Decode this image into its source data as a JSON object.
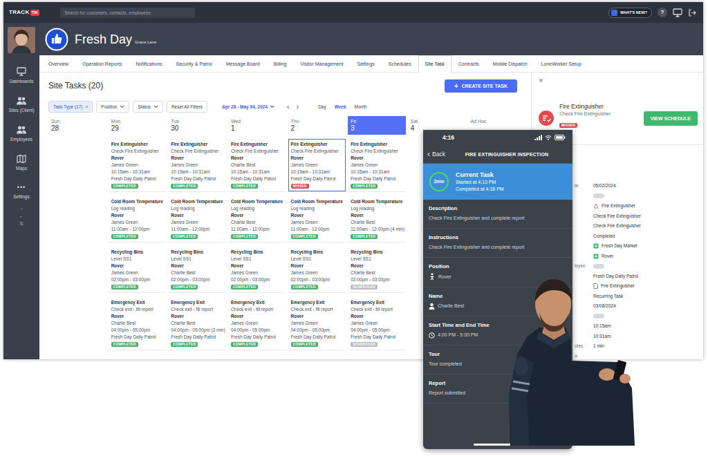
{
  "topbar": {
    "logo": {
      "word": "TRACK",
      "mark": "TIK"
    },
    "search": {
      "placeholder": "Search for customers, contacts, employees"
    },
    "whats_new": "WHAT'S NEW?",
    "help": "?"
  },
  "sidebar": {
    "items": [
      {
        "label": "Dashboards",
        "selected": false
      },
      {
        "label": "Sites (Client)",
        "selected": false
      },
      {
        "label": "Employees",
        "selected": false
      },
      {
        "label": "Maps",
        "selected": false
      },
      {
        "label": "Settings",
        "glyph": "•••",
        "selected": false
      }
    ],
    "arrows": [
      "→",
      "←",
      "⇅"
    ]
  },
  "site": {
    "name": "Fresh Day",
    "contact": "Grace Lane"
  },
  "tabs": [
    {
      "label": "Overview",
      "selected": false
    },
    {
      "label": "Operation Reports",
      "selected": false
    },
    {
      "label": "Notifications",
      "selected": false
    },
    {
      "label": "Security & Patrol",
      "selected": false
    },
    {
      "label": "Message Board",
      "selected": false
    },
    {
      "label": "Billing",
      "selected": false
    },
    {
      "label": "Visitor Management",
      "selected": false
    },
    {
      "label": "Settings",
      "selected": false
    },
    {
      "label": "Schedules",
      "selected": false
    },
    {
      "label": "Site Task",
      "selected": true
    },
    {
      "label": "Contracts",
      "selected": false
    },
    {
      "label": "Mobile Dispatch",
      "selected": false
    },
    {
      "label": "LoneWorker Setup",
      "selected": false
    }
  ],
  "page": {
    "title": "Site Tasks (20)",
    "create": {
      "glyph": "+",
      "label": "CREATE SITE TASK"
    }
  },
  "filters": [
    {
      "label": "Task Type (17)",
      "glyph": "×",
      "kind": "chip"
    },
    {
      "label": "Position",
      "kind": "dropdown"
    },
    {
      "label": "Status",
      "kind": "dropdown"
    },
    {
      "label": "Reset All Filters",
      "kind": "button"
    }
  ],
  "range": {
    "label": "Apr 28 - May 04, 2024",
    "prev": "‹",
    "next": "›"
  },
  "views": [
    {
      "label": "Day",
      "selected": false
    },
    {
      "label": "Week",
      "selected": true
    },
    {
      "label": "Month",
      "selected": false
    }
  ],
  "calendar": {
    "adhoc": "Ad Hoc",
    "days": [
      {
        "weekday": "Sun",
        "date": "28",
        "selected": false,
        "tasks": []
      },
      {
        "weekday": "Mon",
        "date": "29",
        "selected": false,
        "tasks": [
          {
            "title": "Fire Extinguisher",
            "subtitle": "Check Fire Extinguisher",
            "position": "Rover",
            "employee": "James Green",
            "time": "10:15am - 10:31am",
            "route": "Fresh Day Daily Patrol",
            "status": "COMPLETED",
            "color": "#48b16e",
            "selected": false
          },
          {
            "title": "Cold Room Temperature",
            "subtitle": "Log reading",
            "position": "Rover",
            "employee": "James Green",
            "time": "11:00am - 12:00pm",
            "status": "COMPLETED",
            "color": "#48b16e",
            "selected": false
          },
          {
            "title": "Recycling Bins",
            "subtitle": "Level SS1",
            "position": "Rover",
            "employee": "James Green",
            "time": "02:00pm - 03:00pm",
            "status": "COMPLETED",
            "color": "#48b16e",
            "selected": false
          },
          {
            "title": "Emergency Exit",
            "subtitle": "Check exit - fill report",
            "position": "Rover",
            "employee": "Charlie Best",
            "time": "04:00pm - 05:00pm",
            "route": "Fresh Day Daily Patrol",
            "status": "COMPLETED",
            "color": "#48b16e",
            "selected": false
          }
        ]
      },
      {
        "weekday": "Tue",
        "date": "30",
        "selected": false,
        "tasks": [
          {
            "title": "Fire Extinguisher",
            "subtitle": "Check Fire Extinguisher",
            "position": "Rover",
            "employee": "James Green",
            "time": "10:15am - 10:31am",
            "route": "Fresh Day Daily Patrol",
            "status": "COMPLETED",
            "color": "#48b16e",
            "selected": false
          },
          {
            "title": "Cold Room Temperature",
            "subtitle": "Log reading",
            "position": "Rover",
            "employee": "James Green",
            "time": "11:00am - 12:00pm",
            "status": "COMPLETED",
            "color": "#48b16e",
            "selected": false
          },
          {
            "title": "Recycling Bins",
            "subtitle": "Level SS1",
            "position": "Rover",
            "employee": "Charlie Best",
            "time": "02:00pm - 03:00pm",
            "status": "COMPLETED",
            "color": "#48b16e",
            "selected": false
          },
          {
            "title": "Emergency Exit",
            "subtitle": "Check exit - fill report",
            "position": "Rover",
            "employee": "Charlie Best",
            "time": "04:00pm - 05:00pm (3 min)",
            "route": "Fresh Day Daily Patrol",
            "status": "COMPLETED",
            "color": "#48b16e",
            "selected": false
          }
        ]
      },
      {
        "weekday": "Wed",
        "date": "1",
        "selected": false,
        "tasks": [
          {
            "title": "Fire Extinguisher",
            "subtitle": "Check Fire Extinguisher",
            "position": "Rover",
            "employee": "Charlie Best",
            "time": "10:15am - 10:31am",
            "route": "Fresh Day Daily Patrol",
            "status": "COMPLETED",
            "color": "#48b16e",
            "selected": false
          },
          {
            "title": "Cold Room Temperature",
            "subtitle": "Log reading",
            "position": "Rover",
            "employee": "Charlie Best",
            "time": "11:00am - 12:00pm",
            "status": "COMPLETED",
            "color": "#48b16e",
            "selected": false
          },
          {
            "title": "Recycling Bins",
            "subtitle": "Level SS1",
            "position": "Rover",
            "employee": "James Green",
            "time": "02:00pm - 03:00pm",
            "status": "COMPLETED",
            "color": "#48b16e",
            "selected": false
          },
          {
            "title": "Emergency Exit",
            "subtitle": "Check exit - fill report",
            "position": "Rover",
            "employee": "James Green",
            "time": "04:00pm - 05:00pm",
            "route": "Fresh Day Daily Patrol",
            "status": "COMPLETED",
            "color": "#48b16e",
            "selected": false
          }
        ]
      },
      {
        "weekday": "Thu",
        "date": "2",
        "selected": false,
        "tasks": [
          {
            "title": "Fire Extinguisher",
            "subtitle": "Check Fire Extinguisher",
            "position": "Rover",
            "employee": "James Green",
            "time": "10:15am - 10:31am",
            "route": "Fresh Day Daily Patrol",
            "status": "MISSED",
            "color": "#e5484d",
            "selected": true
          },
          {
            "title": "Cold Room Temperature",
            "subtitle": "Log reading",
            "position": "Rover",
            "employee": "James Green",
            "time": "11:00am - 12:00pm",
            "status": "COMPLETED",
            "color": "#48b16e",
            "selected": false
          },
          {
            "title": "Recycling Bins",
            "subtitle": "Level SS1",
            "position": "Rover",
            "employee": "James Green",
            "time": "02:00pm - 03:00pm",
            "status": "COMPLETED",
            "color": "#48b16e",
            "selected": false
          },
          {
            "title": "Emergency Exit",
            "subtitle": "Check exit - fill report",
            "position": "Rover",
            "employee": "James Green",
            "time": "04:00pm - 05:00pm",
            "route": "Fresh Day Daily Patrol",
            "status": "COMPLETED",
            "color": "#48b16e",
            "selected": false
          }
        ]
      },
      {
        "weekday": "Fri",
        "date": "3",
        "selected": true,
        "tasks": [
          {
            "title": "Fire Extinguisher",
            "subtitle": "Check Fire Extinguisher",
            "position": "Rover",
            "employee": "James Green",
            "time": "10:15am - 10:31am",
            "route": "Fresh Day Daily Patrol",
            "status": "COMPLETED",
            "color": "#48b16e",
            "selected": false
          },
          {
            "title": "Cold Room Temperature",
            "subtitle": "Log reading",
            "position": "Rover",
            "employee": "Charlie Best",
            "time": "11:00am - 12:00pm (4 min)",
            "status": "COMPLETED",
            "color": "#48b16e",
            "selected": false
          },
          {
            "title": "Recycling Bins",
            "subtitle": "Level SS1",
            "position": "Rover",
            "employee": "Charlie Best",
            "time": "02:00pm - 03:00pm",
            "status": "SCHEDULED",
            "color": "#b8bcc4",
            "selected": false
          },
          {
            "title": "Emergency Exit",
            "subtitle": "Check exit - fill report",
            "position": "Rover",
            "employee": "James Green",
            "time": "04:00pm - 05:00pm",
            "route": "Fresh Day Daily Patrol",
            "status": "SCHEDULED",
            "color": "#b8bcc4",
            "selected": false
          }
        ]
      },
      {
        "weekday": "Sat",
        "date": "4",
        "selected": false,
        "tasks": []
      }
    ]
  },
  "detail": {
    "close": "×",
    "title": "Fire Extinguisher",
    "subtitle": "Check Fire Extinguisher",
    "status": "MISSED",
    "color": "#e5484d",
    "button": "VIEW SCHEDULE",
    "rows": [
      {
        "label": "te",
        "value": "05/02/2024",
        "kind": "text"
      },
      {
        "kind": "pill"
      },
      {
        "value": "Fire Extinguisher",
        "kind": "task-icon"
      },
      {
        "value": "Check Fire Extinguisher",
        "kind": "text"
      },
      {
        "value": "Check Fire Extinguisher",
        "kind": "text"
      },
      {
        "value": "Completed",
        "kind": "text"
      },
      {
        "value": "Fresh Day Market",
        "kind": "site-icon"
      },
      {
        "value": "Rover",
        "kind": "site-icon"
      },
      {
        "label": "loyee",
        "kind": "pill"
      },
      {
        "value": "Fresh Day Daily Patrol",
        "kind": "text"
      },
      {
        "value": "Fire Extinguisher",
        "kind": "doc-icon"
      },
      {
        "value": "Recurring Task",
        "kind": "text"
      },
      {
        "value": "03/08/2024",
        "kind": "text"
      },
      {
        "kind": "pill"
      },
      {
        "value": "10:15am",
        "kind": "text"
      },
      {
        "value": "10:31am",
        "kind": "text"
      },
      {
        "label": "utes",
        "value": "1 min",
        "kind": "text"
      },
      {
        "label": "rt",
        "kind": "empty"
      }
    ]
  },
  "phone": {
    "time": "4:16",
    "back_glyph": "‹",
    "back": "Back",
    "title": "FIRE EXTINGUISHER INSPECTION",
    "current": {
      "ring": "2min",
      "level": 1,
      "title": "Current Task",
      "started": "Started at 4:13 PM",
      "completed": "Completed at 4:16 PM"
    },
    "sections": [
      {
        "label": "Description",
        "value": "Check Fire Extinguisher and complete report",
        "kind": "text"
      },
      {
        "label": "Instructions",
        "value": "Check Fire Extinguisher and complete report",
        "kind": "text"
      },
      {
        "label": "Position",
        "value": "Rover",
        "kind": "position"
      },
      {
        "label": "Name",
        "value": "Charlie Best",
        "kind": "person"
      },
      {
        "label": "Start Time and End Time",
        "value": "4:00 PM - 5:00 PM",
        "kind": "time"
      },
      {
        "label": "Tour",
        "value": "Tour completed",
        "kind": "text"
      },
      {
        "label": "Report",
        "value": "Report submitted",
        "kind": "text"
      }
    ]
  }
}
